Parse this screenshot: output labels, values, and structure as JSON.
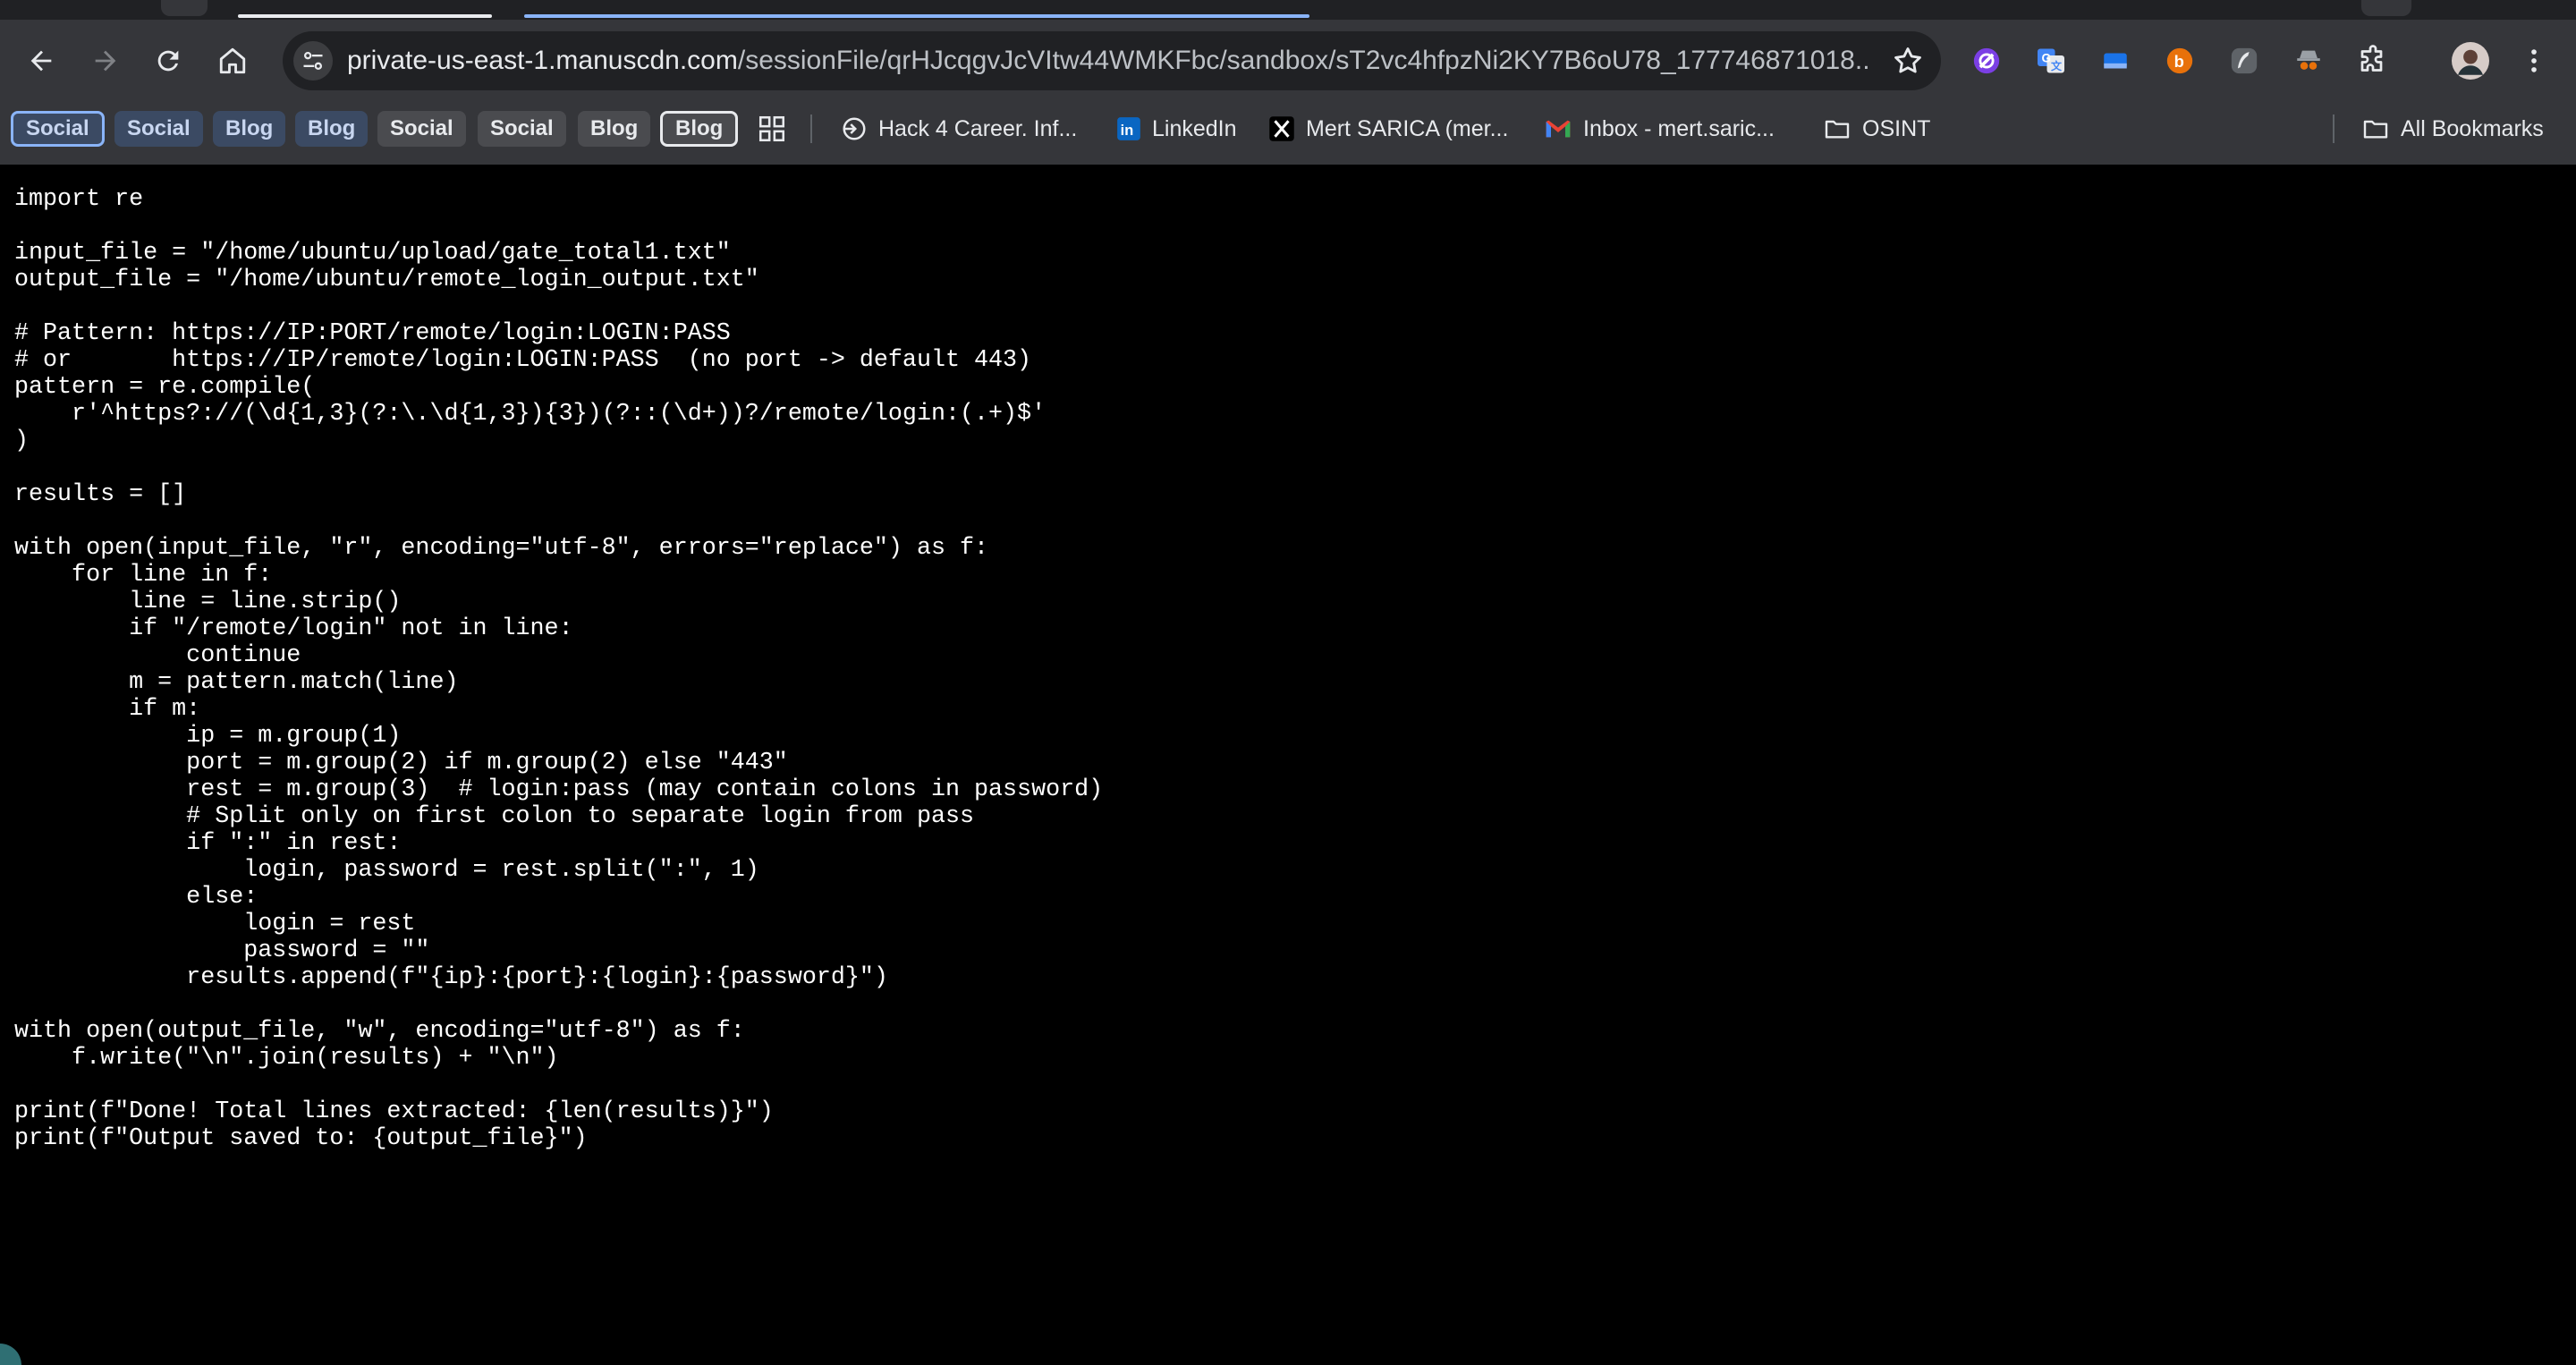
{
  "browser": {
    "url_host": "private-us-east-1.manuscdn.com",
    "url_path": "/sessionFile/qrHJcqgvJcVItw44WMKFbc/sandbox/sT2vc4hfpzNi2KY7B6oU78_177746871018...",
    "icons": {
      "back": "arrow-left-icon",
      "forward": "arrow-right-icon",
      "reload": "reload-icon",
      "home": "home-icon",
      "site_info": "tune-icon",
      "bookmark": "star-icon",
      "extensions": "puzzle-icon",
      "menu": "kebab-icon"
    }
  },
  "bookmarks": {
    "chips": [
      {
        "label": "Social",
        "style": "blue-outlined"
      },
      {
        "label": "Social",
        "style": "blue"
      },
      {
        "label": "Blog",
        "style": "blue"
      },
      {
        "label": "Blog",
        "style": "blue"
      },
      {
        "label": "Social",
        "style": "gray"
      },
      {
        "label": "Social",
        "style": "gray"
      },
      {
        "label": "Blog",
        "style": "gray"
      },
      {
        "label": "Blog",
        "style": "gray-outlined"
      }
    ],
    "items": [
      {
        "label": "Hack 4 Career. Inf...",
        "icon": "hack4career-icon"
      },
      {
        "label": "LinkedIn",
        "icon": "linkedin-icon"
      },
      {
        "label": "Mert SARICA (mer...",
        "icon": "x-icon"
      },
      {
        "label": "Inbox - mert.saric...",
        "icon": "gmail-icon"
      },
      {
        "label": "OSINT",
        "icon": "folder-icon"
      }
    ],
    "all_bookmarks": "All Bookmarks"
  },
  "colors": {
    "toolbar": "#35363a",
    "content_bg": "#000000",
    "tab_accent": "#8ab4f8"
  },
  "code_lines": [
    "import re",
    "",
    "input_file = \"/home/ubuntu/upload/gate_total1.txt\"",
    "output_file = \"/home/ubuntu/remote_login_output.txt\"",
    "",
    "# Pattern: https://IP:PORT/remote/login:LOGIN:PASS",
    "# or       https://IP/remote/login:LOGIN:PASS  (no port -> default 443)",
    "pattern = re.compile(",
    "    r'^https?://(\\d{1,3}(?:\\.\\d{1,3}){3})(?::(\\d+))?/remote/login:(.+)$'",
    ")",
    "",
    "results = []",
    "",
    "with open(input_file, \"r\", encoding=\"utf-8\", errors=\"replace\") as f:",
    "    for line in f:",
    "        line = line.strip()",
    "        if \"/remote/login\" not in line:",
    "            continue",
    "        m = pattern.match(line)",
    "        if m:",
    "            ip = m.group(1)",
    "            port = m.group(2) if m.group(2) else \"443\"",
    "            rest = m.group(3)  # login:pass (may contain colons in password)",
    "            # Split only on first colon to separate login from pass",
    "            if \":\" in rest:",
    "                login, password = rest.split(\":\", 1)",
    "            else:",
    "                login = rest",
    "                password = \"\"",
    "            results.append(f\"{ip}:{port}:{login}:{password}\")",
    "",
    "with open(output_file, \"w\", encoding=\"utf-8\") as f:",
    "    f.write(\"\\n\".join(results) + \"\\n\")",
    "",
    "print(f\"Done! Total lines extracted: {len(results)}\")",
    "print(f\"Output saved to: {output_file}\")"
  ]
}
